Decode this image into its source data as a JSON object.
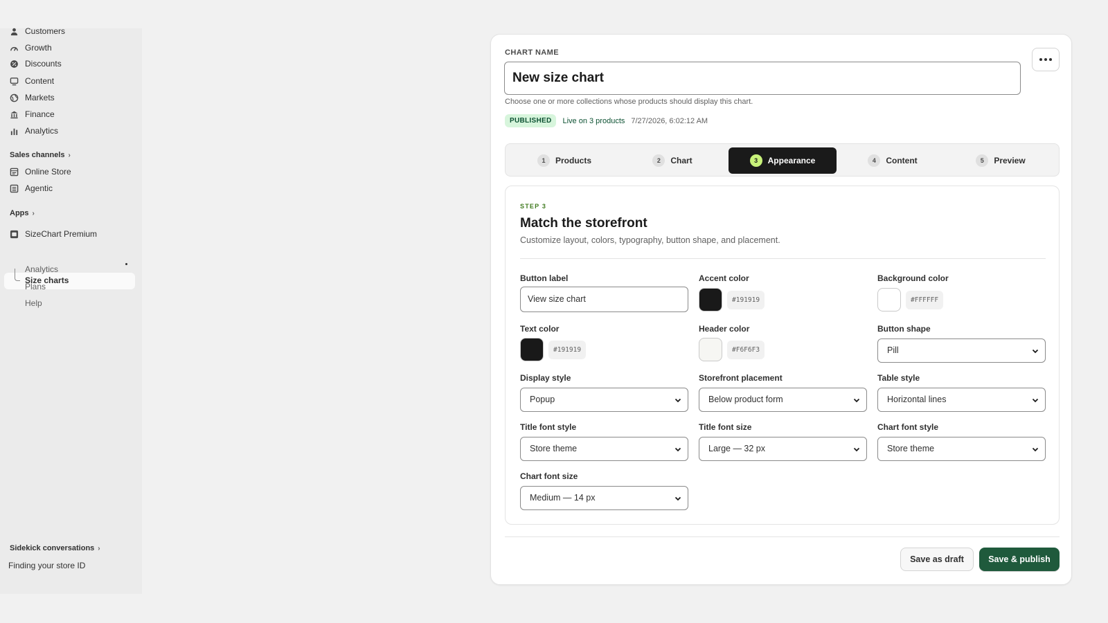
{
  "sidebar": {
    "items": [
      {
        "label": "Customers",
        "icon": "person-icon"
      },
      {
        "label": "Growth",
        "icon": "growth-icon"
      },
      {
        "label": "Discounts",
        "icon": "discount-icon"
      },
      {
        "label": "Content",
        "icon": "content-icon"
      },
      {
        "label": "Markets",
        "icon": "globe-icon"
      },
      {
        "label": "Finance",
        "icon": "bank-icon"
      },
      {
        "label": "Analytics",
        "icon": "bar-chart-icon"
      }
    ],
    "sales_channels_label": "Sales channels",
    "channels": [
      {
        "label": "Online Store",
        "icon": "store-icon"
      },
      {
        "label": "Agentic",
        "icon": "agentic-icon"
      }
    ],
    "apps_label": "Apps",
    "app": {
      "label": "SizeChart Premium",
      "sub_items": [
        "Size charts",
        "Analytics",
        "Plans",
        "Help"
      ]
    },
    "sidekick_label": "Sidekick conversations",
    "sidekick_item": "Finding your store ID"
  },
  "card": {
    "name_label": "CHART NAME",
    "name_value": "New size chart",
    "help_text": "Choose one or more collections whose products should display this chart.",
    "status_badge": "PUBLISHED",
    "status_text": "Live on 3 products",
    "status_time": "7/27/2026, 6:02:12 AM",
    "steps": [
      {
        "num": "1",
        "label": "Products"
      },
      {
        "num": "2",
        "label": "Chart"
      },
      {
        "num": "3",
        "label": "Appearance"
      },
      {
        "num": "4",
        "label": "Content"
      },
      {
        "num": "5",
        "label": "Preview"
      }
    ],
    "active_step": 3,
    "panel": {
      "kicker": "STEP 3",
      "title": "Match the storefront",
      "subtitle": "Customize layout, colors, typography, button shape, and placement.",
      "button_label": {
        "label": "Button label",
        "value": "View size chart"
      },
      "accent_color": {
        "label": "Accent color",
        "hex": "#191919",
        "color": "#191919"
      },
      "background_color": {
        "label": "Background color",
        "hex": "#FFFFFF",
        "color": "#FFFFFF"
      },
      "text_color": {
        "label": "Text color",
        "hex": "#191919",
        "color": "#191919"
      },
      "header_color": {
        "label": "Header color",
        "hex": "#F6F6F3",
        "color": "#F6F6F3"
      },
      "button_shape": {
        "label": "Button shape",
        "value": "Pill"
      },
      "display_style": {
        "label": "Display style",
        "value": "Popup"
      },
      "storefront_placement": {
        "label": "Storefront placement",
        "value": "Below product form"
      },
      "table_style": {
        "label": "Table style",
        "value": "Horizontal lines"
      },
      "title_font_style": {
        "label": "Title font style",
        "value": "Store theme"
      },
      "title_font_size": {
        "label": "Title font size",
        "value": "Large — 32 px"
      },
      "chart_font_style": {
        "label": "Chart font style",
        "value": "Store theme"
      },
      "chart_font_size": {
        "label": "Chart font size",
        "value": "Medium — 14 px"
      }
    },
    "save_draft_label": "Save as draft",
    "save_publish_label": "Save & publish"
  }
}
